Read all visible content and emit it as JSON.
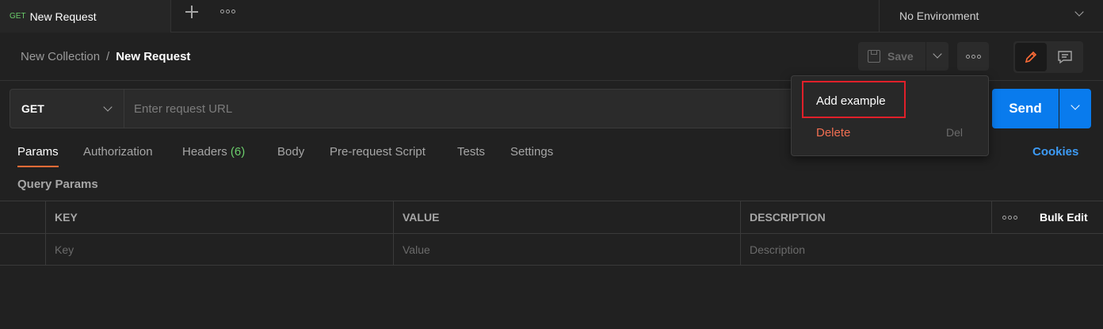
{
  "tabbar": {
    "tab_method": "GET",
    "tab_name": "New Request",
    "environment": "No Environment"
  },
  "header": {
    "collection": "New Collection",
    "separator": "/",
    "request": "New Request",
    "save_label": "Save"
  },
  "url_bar": {
    "method": "GET",
    "placeholder": "Enter request URL",
    "send_label": "Send"
  },
  "request_tabs": {
    "params": "Params",
    "authorization": "Authorization",
    "headers": "Headers",
    "headers_count": "(6)",
    "body": "Body",
    "prerequest": "Pre-request Script",
    "tests": "Tests",
    "settings": "Settings",
    "cookies": "Cookies"
  },
  "query_params": {
    "title": "Query Params",
    "columns": {
      "key": "KEY",
      "value": "VALUE",
      "description": "DESCRIPTION",
      "bulk_edit": "Bulk Edit"
    },
    "placeholders": {
      "key": "Key",
      "value": "Value",
      "description": "Description"
    }
  },
  "menu": {
    "add_example": "Add example",
    "delete": "Delete",
    "delete_shortcut": "Del"
  },
  "colors": {
    "accent": "#ff6c37",
    "send": "#097bed",
    "method_get": "#6bcd6b",
    "highlight_box": "#e0202a",
    "delete": "#f26f52"
  }
}
